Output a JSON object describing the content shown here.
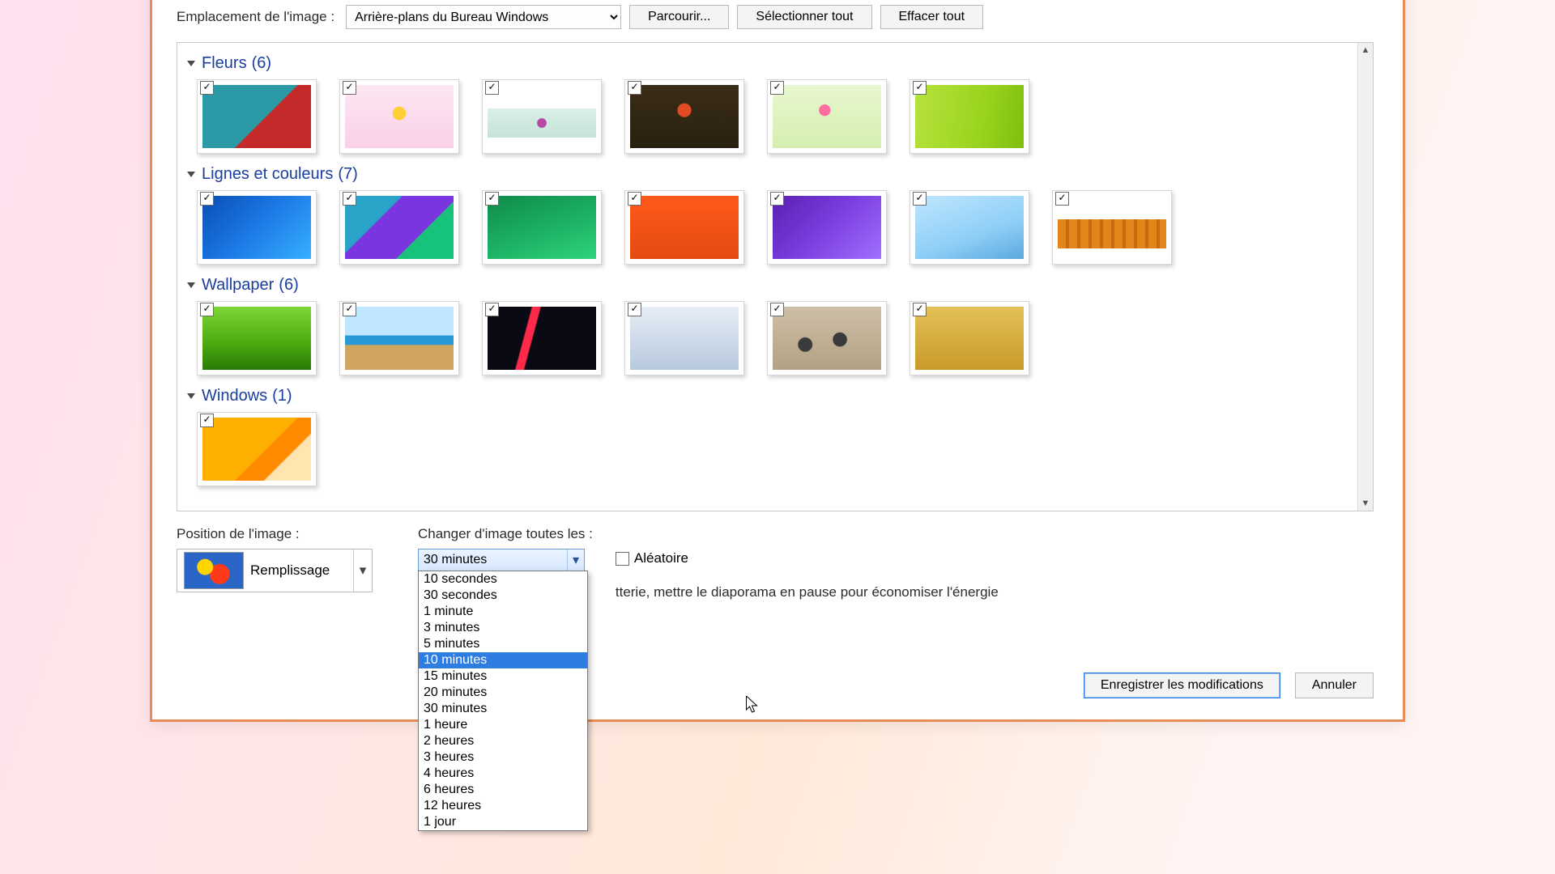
{
  "top": {
    "location_label": "Emplacement de l'image :",
    "location_value": "Arrière-plans du Bureau Windows",
    "browse": "Parcourir...",
    "select_all": "Sélectionner tout",
    "clear_all": "Effacer tout"
  },
  "groups": [
    {
      "name": "Fleurs",
      "count_suffix": "(6)",
      "thumbs": [
        {
          "checked": true,
          "bg": "linear-gradient(135deg,#2a9aa6 0%,#2a9aa6 55%,#c42a2a 56%,#c42a2a 100%)"
        },
        {
          "checked": true,
          "bg": "radial-gradient(circle at 50% 45%, #ffcf3a 0 10%, transparent 11%), linear-gradient(#fde7f3,#f9d0e8)"
        },
        {
          "checked": true,
          "bg": "radial-gradient(circle at 50% 50%, #b84aa3 0 8%, transparent 9%), linear-gradient(#d9efe7,#c7e3d9)",
          "narrow": true
        },
        {
          "checked": true,
          "bg": "radial-gradient(circle at 50% 40%, #e24a22 0 10%, transparent 11%), linear-gradient(#3a2d17,#2a2010)"
        },
        {
          "checked": true,
          "bg": "radial-gradient(circle at 48% 40%, #ff6aa0 0 8%, transparent 9%), linear-gradient(#e9f7d0,#d4efb0)"
        },
        {
          "checked": true,
          "bg": "linear-gradient(100deg,#b7e23d 0%,#9ad41f 60%,#7ebf0f 100%)"
        }
      ]
    },
    {
      "name": "Lignes et couleurs",
      "count_suffix": "(7)",
      "thumbs": [
        {
          "checked": true,
          "bg": "linear-gradient(135deg,#0a4db4 0%,#1c7ae6 50%,#38b0ff 100%)"
        },
        {
          "checked": true,
          "bg": "linear-gradient(135deg,#2aa3c9 0%,#2aa3c9 33%,#7a35e0 34%,#7a35e0 66%,#17c27a 67%)"
        },
        {
          "checked": true,
          "bg": "linear-gradient(160deg,#0f8a4a 0%,#1eb567 60%,#2fd37f 100%)"
        },
        {
          "checked": true,
          "bg": "linear-gradient(#ff5a1a,#e44a10)"
        },
        {
          "checked": true,
          "bg": "linear-gradient(135deg,#5a1eb0 0%,#7c3ee0 50%,#a070ff 100%)"
        },
        {
          "checked": true,
          "bg": "linear-gradient(160deg,#bfe6ff 0%,#8fcff6 60%,#5aa9e0 100%)"
        },
        {
          "checked": true,
          "bg": "repeating-linear-gradient(90deg,#e0861a 0 10px,#c96a10 10px 14px), linear-gradient(#2a3a6a,#2a3a6a)",
          "narrow": true
        }
      ]
    },
    {
      "name": "Wallpaper",
      "count_suffix": "(6)",
      "thumbs": [
        {
          "checked": true,
          "bg": "linear-gradient(#7fd636,#4aa80e 60%,#2a7a06)"
        },
        {
          "checked": true,
          "bg": "linear-gradient(#bfe6ff 0 45%,#2a9ad6 46% 60%,#d0a560 61%)"
        },
        {
          "checked": true,
          "bg": "linear-gradient(105deg,#0a0a14 0%,#0a0a14 35%,#ff2a4a 36%,#ff2a4a 42%,#0a0a14 43%)"
        },
        {
          "checked": true,
          "bg": "linear-gradient(#e6eef6,#b8c9de)"
        },
        {
          "checked": true,
          "bg": "radial-gradient(circle at 30% 60%, #3a3a3a 0 8%, transparent 9%), radial-gradient(circle at 62% 52%, #3a3a3a 0 9%, transparent 10%), linear-gradient(#cdbfa7,#b3a184)"
        },
        {
          "checked": true,
          "bg": "linear-gradient(#e3c157,#c89a2a)"
        }
      ]
    },
    {
      "name": "Windows",
      "count_suffix": "(1)",
      "thumbs": [
        {
          "checked": true,
          "bg": "linear-gradient(135deg,#ffb000 0%,#ffb000 55%,#ff8a00 56%,#ff8a00 72%,#ffe6b0 73%)"
        }
      ]
    }
  ],
  "bottom": {
    "position_label": "Position de l'image :",
    "position_value": "Remplissage",
    "interval_label": "Changer d'image toutes les :",
    "interval_value": "30 minutes",
    "interval_options": [
      "10 secondes",
      "30 secondes",
      "1 minute",
      "3 minutes",
      "5 minutes",
      "10 minutes",
      "15 minutes",
      "20 minutes",
      "30 minutes",
      "1 heure",
      "2 heures",
      "3 heures",
      "4 heures",
      "6 heures",
      "12 heures",
      "1 jour"
    ],
    "interval_hover_index": 5,
    "shuffle_label": "Aléatoire",
    "battery_note": "tterie, mettre le diaporama en pause pour économiser l'énergie"
  },
  "footer": {
    "save": "Enregistrer les modifications",
    "cancel": "Annuler"
  }
}
